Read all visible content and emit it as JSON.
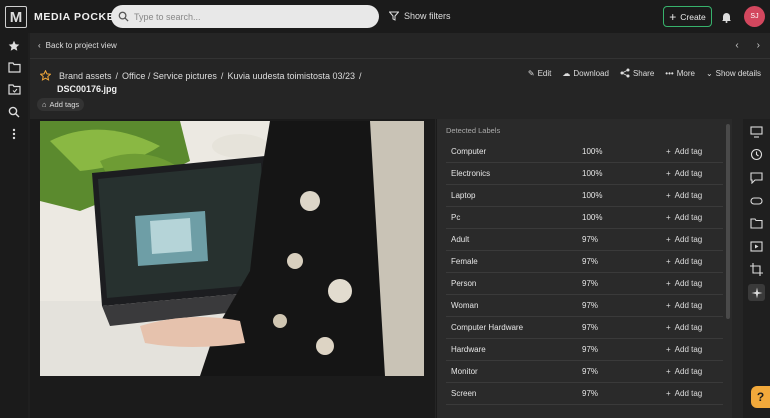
{
  "app": {
    "brand": "MEDIA POCKET",
    "logo_letter": "M"
  },
  "topbar": {
    "search_placeholder": "Type to search...",
    "filters_label": "Show filters",
    "create_label": "Create",
    "avatar_initials": "SJ",
    "avatar_color": "#d3475e",
    "accent_color": "#37b26c"
  },
  "nav": {
    "back_label": "Back to project view"
  },
  "breadcrumb": [
    "Brand assets",
    "Office / Service pictures",
    "Kuvia uudesta toimistosta 03/23"
  ],
  "asset": {
    "filename": "DSC00176.jpg",
    "add_tags_label": "Add tags"
  },
  "actions": {
    "edit": "Edit",
    "download": "Download",
    "share": "Share",
    "more": "More",
    "details": "Show details"
  },
  "labels": {
    "title": "Detected Labels",
    "add_tag_label": "Add tag",
    "items": [
      {
        "name": "Computer",
        "confidence": "100%"
      },
      {
        "name": "Electronics",
        "confidence": "100%"
      },
      {
        "name": "Laptop",
        "confidence": "100%"
      },
      {
        "name": "Pc",
        "confidence": "100%"
      },
      {
        "name": "Adult",
        "confidence": "97%"
      },
      {
        "name": "Female",
        "confidence": "97%"
      },
      {
        "name": "Person",
        "confidence": "97%"
      },
      {
        "name": "Woman",
        "confidence": "97%"
      },
      {
        "name": "Computer Hardware",
        "confidence": "97%"
      },
      {
        "name": "Hardware",
        "confidence": "97%"
      },
      {
        "name": "Monitor",
        "confidence": "97%"
      },
      {
        "name": "Screen",
        "confidence": "97%"
      }
    ]
  },
  "help_label": "?"
}
